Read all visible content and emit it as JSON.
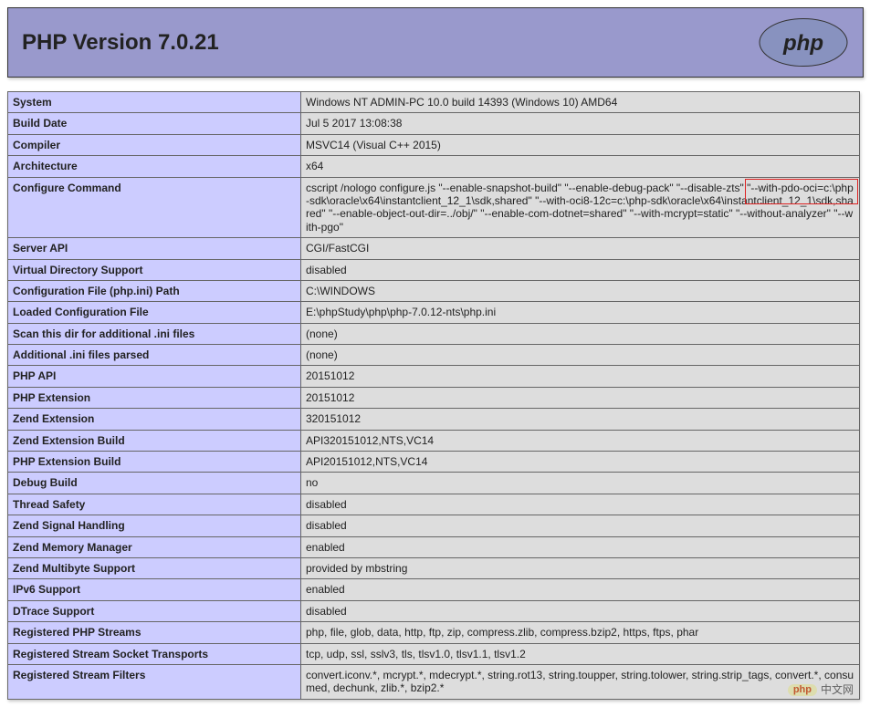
{
  "title": "PHP Version 7.0.21",
  "rows": [
    {
      "k": "System",
      "v": "Windows NT ADMIN-PC 10.0 build 14393 (Windows 10) AMD64"
    },
    {
      "k": "Build Date",
      "v": "Jul 5 2017 13:08:38"
    },
    {
      "k": "Compiler",
      "v": "MSVC14 (Visual C++ 2015)"
    },
    {
      "k": "Architecture",
      "v": "x64"
    },
    {
      "k": "Configure Command",
      "v": "cscript /nologo configure.js \"--enable-snapshot-build\" \"--enable-debug-pack\" \"--disable-zts\" \"--with-pdo-oci=c:\\php-sdk\\oracle\\x64\\instantclient_12_1\\sdk,shared\" \"--with-oci8-12c=c:\\php-sdk\\oracle\\x64\\instantclient_12_1\\sdk,shared\" \"--enable-object-out-dir=../obj/\" \"--enable-com-dotnet=shared\" \"--with-mcrypt=static\" \"--without-analyzer\" \"--with-pgo\"",
      "highlight": true
    },
    {
      "k": "Server API",
      "v": "CGI/FastCGI"
    },
    {
      "k": "Virtual Directory Support",
      "v": "disabled"
    },
    {
      "k": "Configuration File (php.ini) Path",
      "v": "C:\\WINDOWS"
    },
    {
      "k": "Loaded Configuration File",
      "v": "E:\\phpStudy\\php\\php-7.0.12-nts\\php.ini"
    },
    {
      "k": "Scan this dir for additional .ini files",
      "v": "(none)"
    },
    {
      "k": "Additional .ini files parsed",
      "v": "(none)"
    },
    {
      "k": "PHP API",
      "v": "20151012"
    },
    {
      "k": "PHP Extension",
      "v": "20151012"
    },
    {
      "k": "Zend Extension",
      "v": "320151012"
    },
    {
      "k": "Zend Extension Build",
      "v": "API320151012,NTS,VC14"
    },
    {
      "k": "PHP Extension Build",
      "v": "API20151012,NTS,VC14"
    },
    {
      "k": "Debug Build",
      "v": "no"
    },
    {
      "k": "Thread Safety",
      "v": "disabled"
    },
    {
      "k": "Zend Signal Handling",
      "v": "disabled"
    },
    {
      "k": "Zend Memory Manager",
      "v": "enabled"
    },
    {
      "k": "Zend Multibyte Support",
      "v": "provided by mbstring"
    },
    {
      "k": "IPv6 Support",
      "v": "enabled"
    },
    {
      "k": "DTrace Support",
      "v": "disabled"
    },
    {
      "k": "Registered PHP Streams",
      "v": "php, file, glob, data, http, ftp, zip, compress.zlib, compress.bzip2, https, ftps, phar"
    },
    {
      "k": "Registered Stream Socket Transports",
      "v": "tcp, udp, ssl, sslv3, tls, tlsv1.0, tlsv1.1, tlsv1.2"
    },
    {
      "k": "Registered Stream Filters",
      "v": "convert.iconv.*, mcrypt.*, mdecrypt.*, string.rot13, string.toupper, string.tolower, string.strip_tags, convert.*, consumed, dechunk, zlib.*, bzip2.*",
      "watermark": true
    }
  ],
  "watermark": {
    "badge": "php",
    "text": "中文网"
  }
}
